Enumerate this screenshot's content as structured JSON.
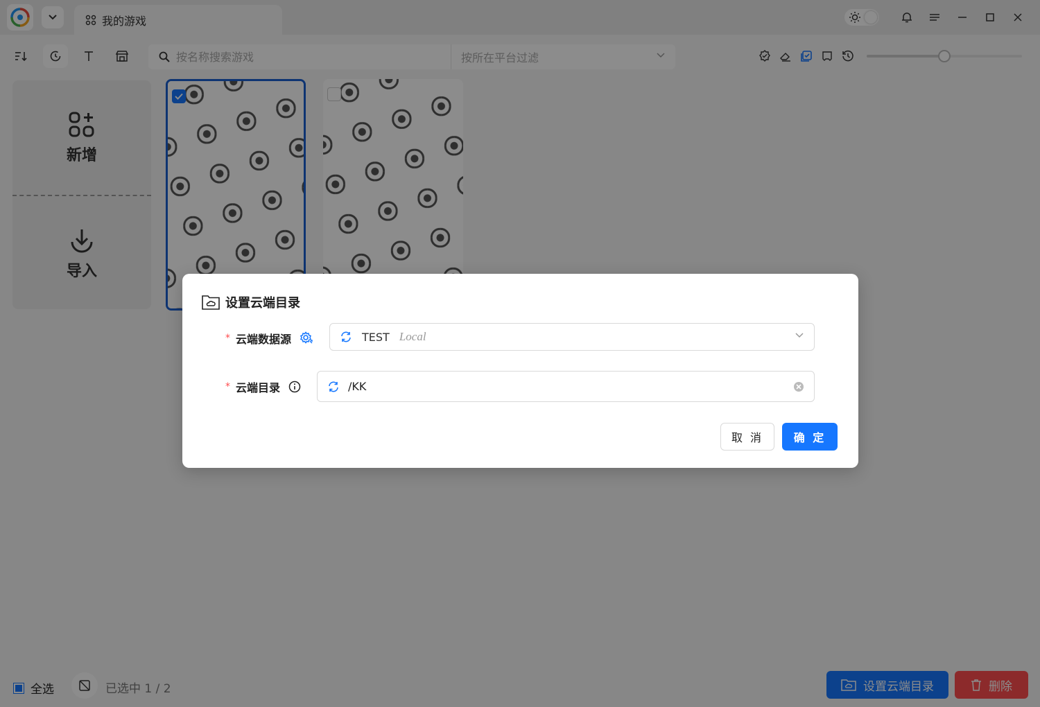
{
  "titlebar": {
    "tab_label": "我的游戏",
    "icons": [
      "app-logo",
      "chevron-down-icon",
      "grid-icon",
      "sun-icon",
      "bell-icon",
      "menu-icon",
      "minimize-icon",
      "maximize-icon",
      "close-icon"
    ]
  },
  "toolbar": {
    "search_placeholder": "按名称搜索游戏",
    "platform_placeholder": "按所在平台过滤",
    "zoom_level": 0.5
  },
  "add_panel": {
    "add_label": "新增",
    "import_label": "导入"
  },
  "games": [
    {
      "selected": true
    },
    {
      "selected": false
    }
  ],
  "bottom": {
    "select_all_label": "全选",
    "selected_count": "已选中 1 / 2",
    "cloud_button_label": "设置云端目录",
    "delete_button_label": "删除"
  },
  "colors": {
    "primary": "#1677ff",
    "danger": "#ff4d4f",
    "selected_border": "#1a5fd0"
  },
  "modal": {
    "title": "设置云端目录",
    "source_label": "云端数据源",
    "source_value": "TEST",
    "source_sub": "Local",
    "dir_label": "云端目录",
    "dir_value": "/KK",
    "cancel_label": "取 消",
    "ok_label": "确 定"
  }
}
